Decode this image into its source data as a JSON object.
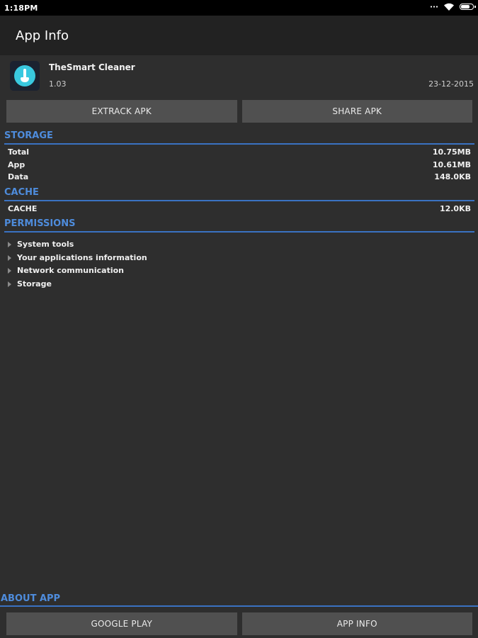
{
  "status_bar": {
    "time": "1:18PM",
    "battery_level": 0.85
  },
  "header": {
    "title": "App Info"
  },
  "app": {
    "name": "TheSmart Cleaner",
    "version": "1.03",
    "date": "23-12-2015"
  },
  "actions_top": {
    "extract_label": "EXTRACK APK",
    "share_label": "SHARE APK"
  },
  "storage": {
    "title": "STORAGE",
    "rows": [
      {
        "label": "Total",
        "value": "10.75MB"
      },
      {
        "label": "App",
        "value": "10.61MB"
      },
      {
        "label": "Data",
        "value": "148.0KB"
      }
    ]
  },
  "cache": {
    "title": "CACHE",
    "rows": [
      {
        "label": "CACHE",
        "value": "12.0KB"
      }
    ]
  },
  "permissions": {
    "title": "PERMISSIONS",
    "items": [
      "System tools",
      "Your applications information",
      "Network communication",
      "Storage"
    ]
  },
  "about": {
    "title": "ABOUT APP",
    "google_play_label": "GOOGLE PLAY",
    "app_info_label": "APP INFO"
  },
  "colors": {
    "accent": "#4e8cdc",
    "divider": "#3a72c2",
    "button_bg": "#505050",
    "background": "#2e2e2e"
  }
}
